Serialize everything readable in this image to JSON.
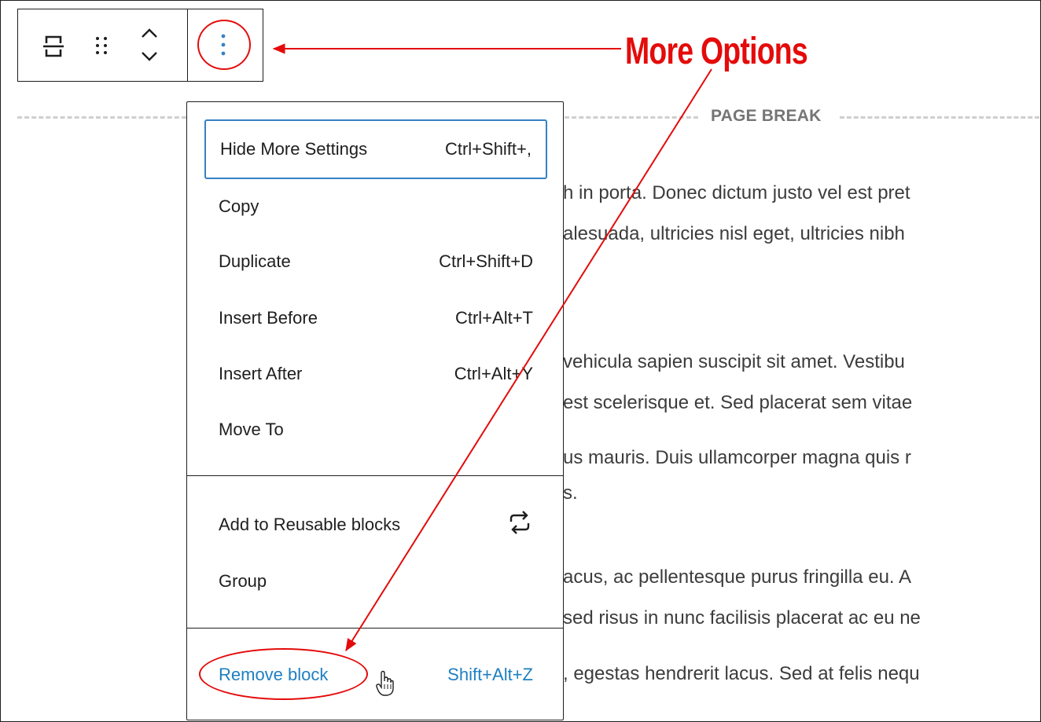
{
  "toolbar": {
    "icons": [
      "page-break-block-icon",
      "drag-handle-icon",
      "move-up-icon",
      "move-down-icon",
      "more-options-icon"
    ]
  },
  "page_break": {
    "label": "PAGE BREAK"
  },
  "paragraphs": [
    "h in porta. Donec dictum justo vel est pret",
    "alesuada, ultricies nisl eget, ultricies nibh",
    "vehicula sapien suscipit sit amet. Vestibu",
    "est scelerisque et. Sed placerat sem vitae",
    "us mauris. Duis ullamcorper magna quis r",
    "s.",
    "acus, ac pellentesque purus fringilla eu. A",
    "sed risus in nunc facilisis placerat ac eu ne",
    ", egestas hendrerit lacus. Sed at felis nequ"
  ],
  "menu": {
    "hide_more_settings": {
      "label": "Hide More Settings",
      "shortcut": "Ctrl+Shift+,"
    },
    "copy": {
      "label": "Copy"
    },
    "duplicate": {
      "label": "Duplicate",
      "shortcut": "Ctrl+Shift+D"
    },
    "insert_before": {
      "label": "Insert Before",
      "shortcut": "Ctrl+Alt+T"
    },
    "insert_after": {
      "label": "Insert After",
      "shortcut": "Ctrl+Alt+Y"
    },
    "move_to": {
      "label": "Move To"
    },
    "add_reusable": {
      "label": "Add to Reusable blocks",
      "icon": "reusable-block-icon"
    },
    "group": {
      "label": "Group"
    },
    "remove_block": {
      "label": "Remove block",
      "shortcut": "Shift+Alt+Z"
    }
  },
  "annotation": {
    "callout": "More Options",
    "color": "#e40b0b"
  },
  "colors": {
    "focus": "#3582c4",
    "danger_link": "#1e7fc2"
  }
}
